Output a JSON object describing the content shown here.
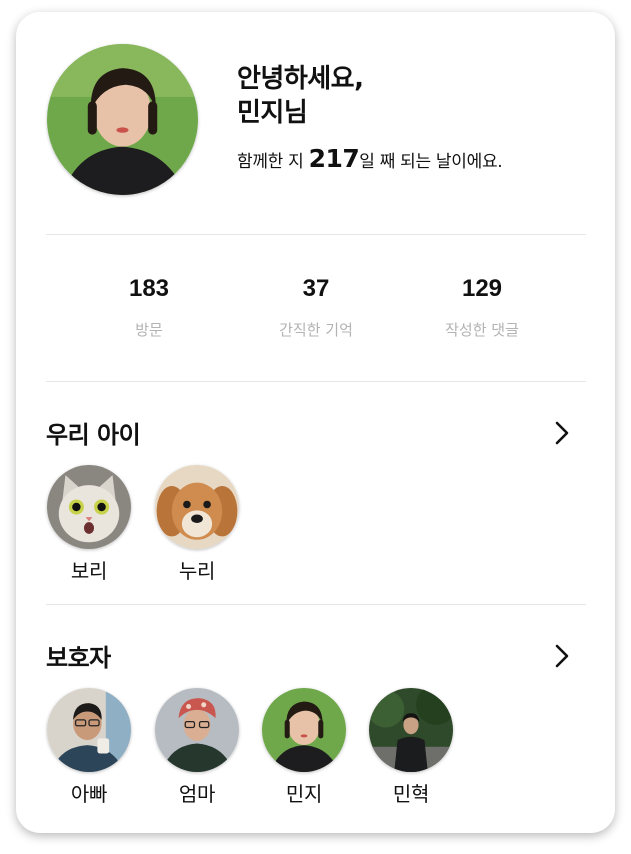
{
  "profile": {
    "greeting_line1": "안녕하세요,",
    "greeting_line2": "민지님",
    "since_prefix": "함께한 지",
    "since_days": "217",
    "since_suffix": "일 째 되는 날이에요.",
    "avatar_icon": "profile-photo"
  },
  "stats": [
    {
      "value": "183",
      "label": "방문"
    },
    {
      "value": "37",
      "label": "간직한 기억"
    },
    {
      "value": "129",
      "label": "작성한 댓글"
    }
  ],
  "pets": {
    "title": "우리 아이",
    "more_icon": "chevron-right-icon",
    "items": [
      {
        "name": "보리",
        "icon": "cat-photo"
      },
      {
        "name": "누리",
        "icon": "dog-photo"
      }
    ]
  },
  "guardians": {
    "title": "보호자",
    "more_icon": "chevron-right-icon",
    "items": [
      {
        "name": "아빠",
        "icon": "person-photo"
      },
      {
        "name": "엄마",
        "icon": "person-photo"
      },
      {
        "name": "민지",
        "icon": "person-photo"
      },
      {
        "name": "민혁",
        "icon": "person-photo"
      }
    ]
  },
  "colors": {
    "card_bg": "#ffffff",
    "divider": "#e6e6e6",
    "muted_text": "#b3b3b3",
    "primary_text": "#111111"
  }
}
